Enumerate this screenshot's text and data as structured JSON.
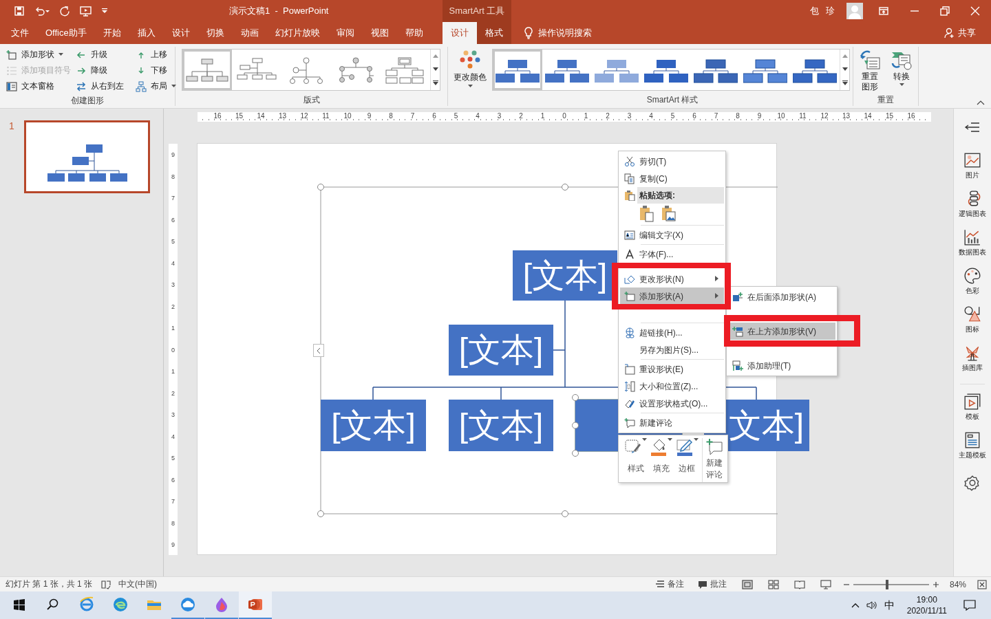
{
  "title_bar": {
    "document_title": "演示文稿1  -  PowerPoint",
    "context_label": "SmartArt 工具",
    "user_name": "包 珍"
  },
  "tabs": [
    {
      "label": "文件",
      "selected": false,
      "contextual": false
    },
    {
      "label": "Office助手",
      "selected": false,
      "contextual": false
    },
    {
      "label": "开始",
      "selected": false,
      "contextual": false
    },
    {
      "label": "插入",
      "selected": false,
      "contextual": false
    },
    {
      "label": "设计",
      "selected": false,
      "contextual": false
    },
    {
      "label": "切换",
      "selected": false,
      "contextual": false
    },
    {
      "label": "动画",
      "selected": false,
      "contextual": false
    },
    {
      "label": "幻灯片放映",
      "selected": false,
      "contextual": false
    },
    {
      "label": "审阅",
      "selected": false,
      "contextual": false
    },
    {
      "label": "视图",
      "selected": false,
      "contextual": false
    },
    {
      "label": "帮助",
      "selected": false,
      "contextual": false
    },
    {
      "label": "设计",
      "selected": true,
      "contextual": true
    },
    {
      "label": "格式",
      "selected": false,
      "contextual": true
    }
  ],
  "tell_me": {
    "label": "操作说明搜索"
  },
  "share": {
    "label": "共享"
  },
  "ribbon": {
    "create_graphic": {
      "label": "创建图形",
      "buttons": [
        {
          "label": "添加形状",
          "disabled": false,
          "dropdown": true
        },
        {
          "label": "升级",
          "disabled": false,
          "dropdown": false
        },
        {
          "label": "上移",
          "disabled": false,
          "dropdown": false
        },
        {
          "label": "添加项目符号",
          "disabled": true,
          "dropdown": false
        },
        {
          "label": "降级",
          "disabled": false,
          "dropdown": false
        },
        {
          "label": "下移",
          "disabled": false,
          "dropdown": false
        },
        {
          "label": "文本窗格",
          "disabled": false,
          "dropdown": false
        },
        {
          "label": "从右到左",
          "disabled": false,
          "dropdown": false
        },
        {
          "label": "布局",
          "disabled": false,
          "dropdown": true
        }
      ]
    },
    "layouts": {
      "label": "版式",
      "items": [
        {
          "selected": true
        },
        {
          "selected": false
        },
        {
          "selected": false
        },
        {
          "selected": false
        },
        {
          "selected": false
        }
      ]
    },
    "change_colors": {
      "label": "更改颜色"
    },
    "styles": {
      "label": "SmartArt 样式",
      "items": [
        {
          "selected": true
        },
        {
          "selected": false
        },
        {
          "selected": false
        },
        {
          "selected": false
        },
        {
          "selected": false
        },
        {
          "selected": false
        },
        {
          "selected": false
        }
      ]
    },
    "reset": {
      "label": "重置",
      "buttons": [
        {
          "label": "重置图形",
          "dropdown": false
        },
        {
          "label": "转换",
          "dropdown": true
        }
      ]
    }
  },
  "thumbnails": [
    {
      "number": "1",
      "selected": true
    }
  ],
  "rulers": {
    "horizontal": [
      "16",
      "15",
      "14",
      "13",
      "12",
      "11",
      "10",
      "9",
      "8",
      "7",
      "6",
      "5",
      "4",
      "3",
      "2",
      "1",
      "0",
      "1",
      "2",
      "3",
      "4",
      "5",
      "6",
      "7",
      "8",
      "9",
      "10",
      "11",
      "12",
      "13",
      "14",
      "15",
      "16"
    ],
    "vertical": [
      "9",
      "8",
      "7",
      "6",
      "5",
      "4",
      "3",
      "2",
      "1",
      "0",
      "1",
      "2",
      "3",
      "4",
      "5",
      "6",
      "7",
      "8",
      "9"
    ]
  },
  "diagram": {
    "nodes": [
      {
        "text": "[文本]",
        "selected": false
      },
      {
        "text": "[文本]",
        "selected": false
      },
      {
        "text": "[文本]",
        "selected": false
      },
      {
        "text": "[文本]",
        "selected": false
      },
      {
        "selected": true
      },
      {
        "text": "文本]",
        "selected": false
      }
    ]
  },
  "context_menu": {
    "items": [
      {
        "kind": "item",
        "label": "剪切(T)",
        "selected": false,
        "submenu": false
      },
      {
        "kind": "item",
        "label": "复制(C)",
        "selected": false,
        "submenu": false
      },
      {
        "kind": "header",
        "label": "粘贴选项:"
      },
      {
        "kind": "paste"
      },
      {
        "kind": "separator"
      },
      {
        "kind": "item",
        "label": "编辑文字(X)",
        "selected": false,
        "submenu": false
      },
      {
        "kind": "separator"
      },
      {
        "kind": "item",
        "label": "字体(F)...",
        "selected": false,
        "submenu": false
      },
      {
        "kind": "item",
        "label": "更改形状(N)",
        "selected": false,
        "submenu": true
      },
      {
        "kind": "item",
        "label": "添加形状(A)",
        "selected": true,
        "submenu": true
      },
      {
        "kind": "obscured"
      },
      {
        "kind": "separator"
      },
      {
        "kind": "item",
        "label": "超链接(H)...",
        "selected": false,
        "submenu": false
      },
      {
        "kind": "item",
        "label": "另存为图片(S)...",
        "selected": false,
        "submenu": false
      },
      {
        "kind": "separator"
      },
      {
        "kind": "item",
        "label": "重设形状(E)",
        "selected": false,
        "submenu": false
      },
      {
        "kind": "item",
        "label": "大小和位置(Z)...",
        "selected": false,
        "submenu": false
      },
      {
        "kind": "item",
        "label": "设置形状格式(O)...",
        "selected": false,
        "submenu": false
      },
      {
        "kind": "separator"
      },
      {
        "kind": "item",
        "label": "新建评论",
        "selected": false,
        "submenu": false
      }
    ]
  },
  "submenu": {
    "items": [
      {
        "kind": "item",
        "label": "在后面添加形状(A)",
        "selected": false
      },
      {
        "kind": "obscured"
      },
      {
        "kind": "item",
        "label": "在上方添加形状(V)",
        "selected": true
      },
      {
        "kind": "obscured"
      },
      {
        "kind": "item",
        "label": "添加助理(T)",
        "selected": false
      }
    ]
  },
  "mini_toolbar": {
    "buttons": [
      {
        "label": "样式",
        "dropdown": true
      },
      {
        "label": "填充",
        "dropdown": true
      },
      {
        "label": "边框",
        "dropdown": true
      },
      {
        "label": "新建评论",
        "dropdown": false
      }
    ]
  },
  "side_pane": {
    "items": [
      "图片",
      "逻辑图表",
      "数据图表",
      "色彩",
      "图标",
      "插图库",
      "模板",
      "主题模板"
    ]
  },
  "status_bar": {
    "slide_info": "幻灯片 第 1 张，共 1 张",
    "language": "中文(中国)",
    "notes": "备注",
    "comments": "批注",
    "zoom": {
      "level": 0.45,
      "reading": "84%"
    }
  },
  "taskbar": {
    "apps": [
      {
        "running": false,
        "selected": false
      },
      {
        "running": false,
        "selected": false
      },
      {
        "running": false,
        "selected": false
      },
      {
        "running": true,
        "selected": false
      },
      {
        "running": true,
        "selected": false
      },
      {
        "running": true,
        "selected": true
      }
    ],
    "input_method": "中",
    "time": "19:00",
    "date": "2020/11/11"
  }
}
